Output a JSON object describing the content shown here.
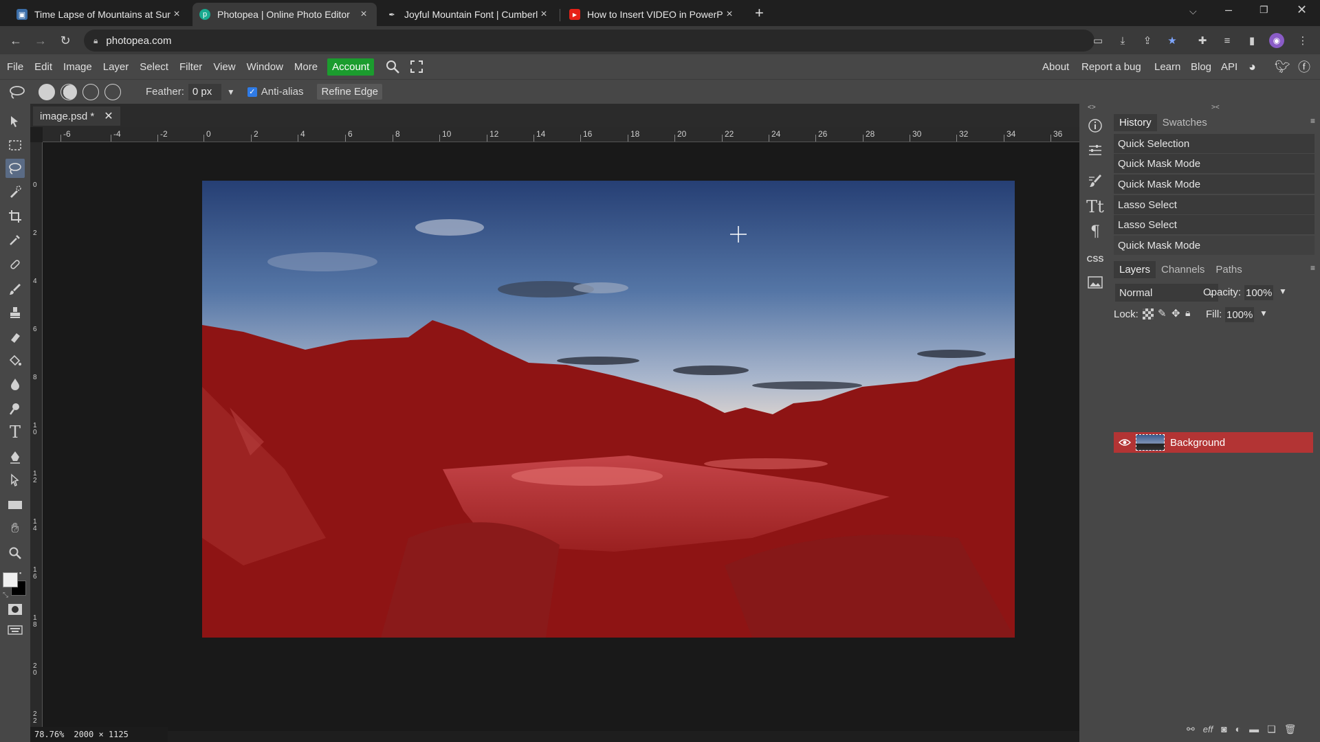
{
  "browser": {
    "tabs": [
      {
        "title": "Time Lapse of Mountains at Suns",
        "favicon": "image-icon",
        "active": false
      },
      {
        "title": "Photopea | Online Photo Editor",
        "favicon": "photopea-icon",
        "active": true
      },
      {
        "title": "Joyful Mountain Font | Cumberla",
        "favicon": "feather-icon",
        "active": false
      },
      {
        "title": "How to Insert VIDEO in PowerPoi",
        "favicon": "youtube-icon",
        "active": false
      }
    ],
    "url": "photopea.com"
  },
  "menubar": {
    "items": [
      "File",
      "Edit",
      "Image",
      "Layer",
      "Select",
      "Filter",
      "View",
      "Window",
      "More"
    ],
    "account": "Account",
    "right_links": [
      "About",
      "Report a bug",
      "Learn",
      "Blog",
      "API"
    ]
  },
  "options": {
    "feather_label": "Feather:",
    "feather_value": "0 px",
    "antialias_label": "Anti-alias",
    "antialias_checked": true,
    "refine_edge": "Refine Edge"
  },
  "document": {
    "tab_title": "image.psd *",
    "zoom": "78.76%",
    "dimensions": "2000 × 1125"
  },
  "rulers": {
    "h_ticks": [
      "-6",
      "-4",
      "-2",
      "0",
      "2",
      "4",
      "6",
      "8",
      "10",
      "12",
      "14",
      "16",
      "18",
      "20",
      "22",
      "24",
      "26",
      "28",
      "30",
      "32",
      "34",
      "36"
    ],
    "v_ticks": [
      "0",
      "2",
      "4",
      "6",
      "8",
      "10",
      "12",
      "14",
      "16",
      "18",
      "20",
      "22"
    ]
  },
  "history_panel": {
    "tabs": [
      "History",
      "Swatches"
    ],
    "items": [
      "Quick Selection",
      "Quick Mask Mode",
      "Quick Mask Mode",
      "Lasso Select",
      "Lasso Select",
      "Quick Mask Mode"
    ]
  },
  "layers_panel": {
    "tabs": [
      "Layers",
      "Channels",
      "Paths"
    ],
    "blend_mode": "Normal",
    "opacity_label": "Opacity:",
    "opacity_value": "100%",
    "lock_label": "Lock:",
    "fill_label": "Fill:",
    "fill_value": "100%",
    "layers": [
      {
        "name": "Background",
        "visible": true,
        "selected": true
      }
    ]
  },
  "colors": {
    "accent_green": "#1b9c2e",
    "selected_layer": "#b33434",
    "quick_mask": "#a01818"
  }
}
